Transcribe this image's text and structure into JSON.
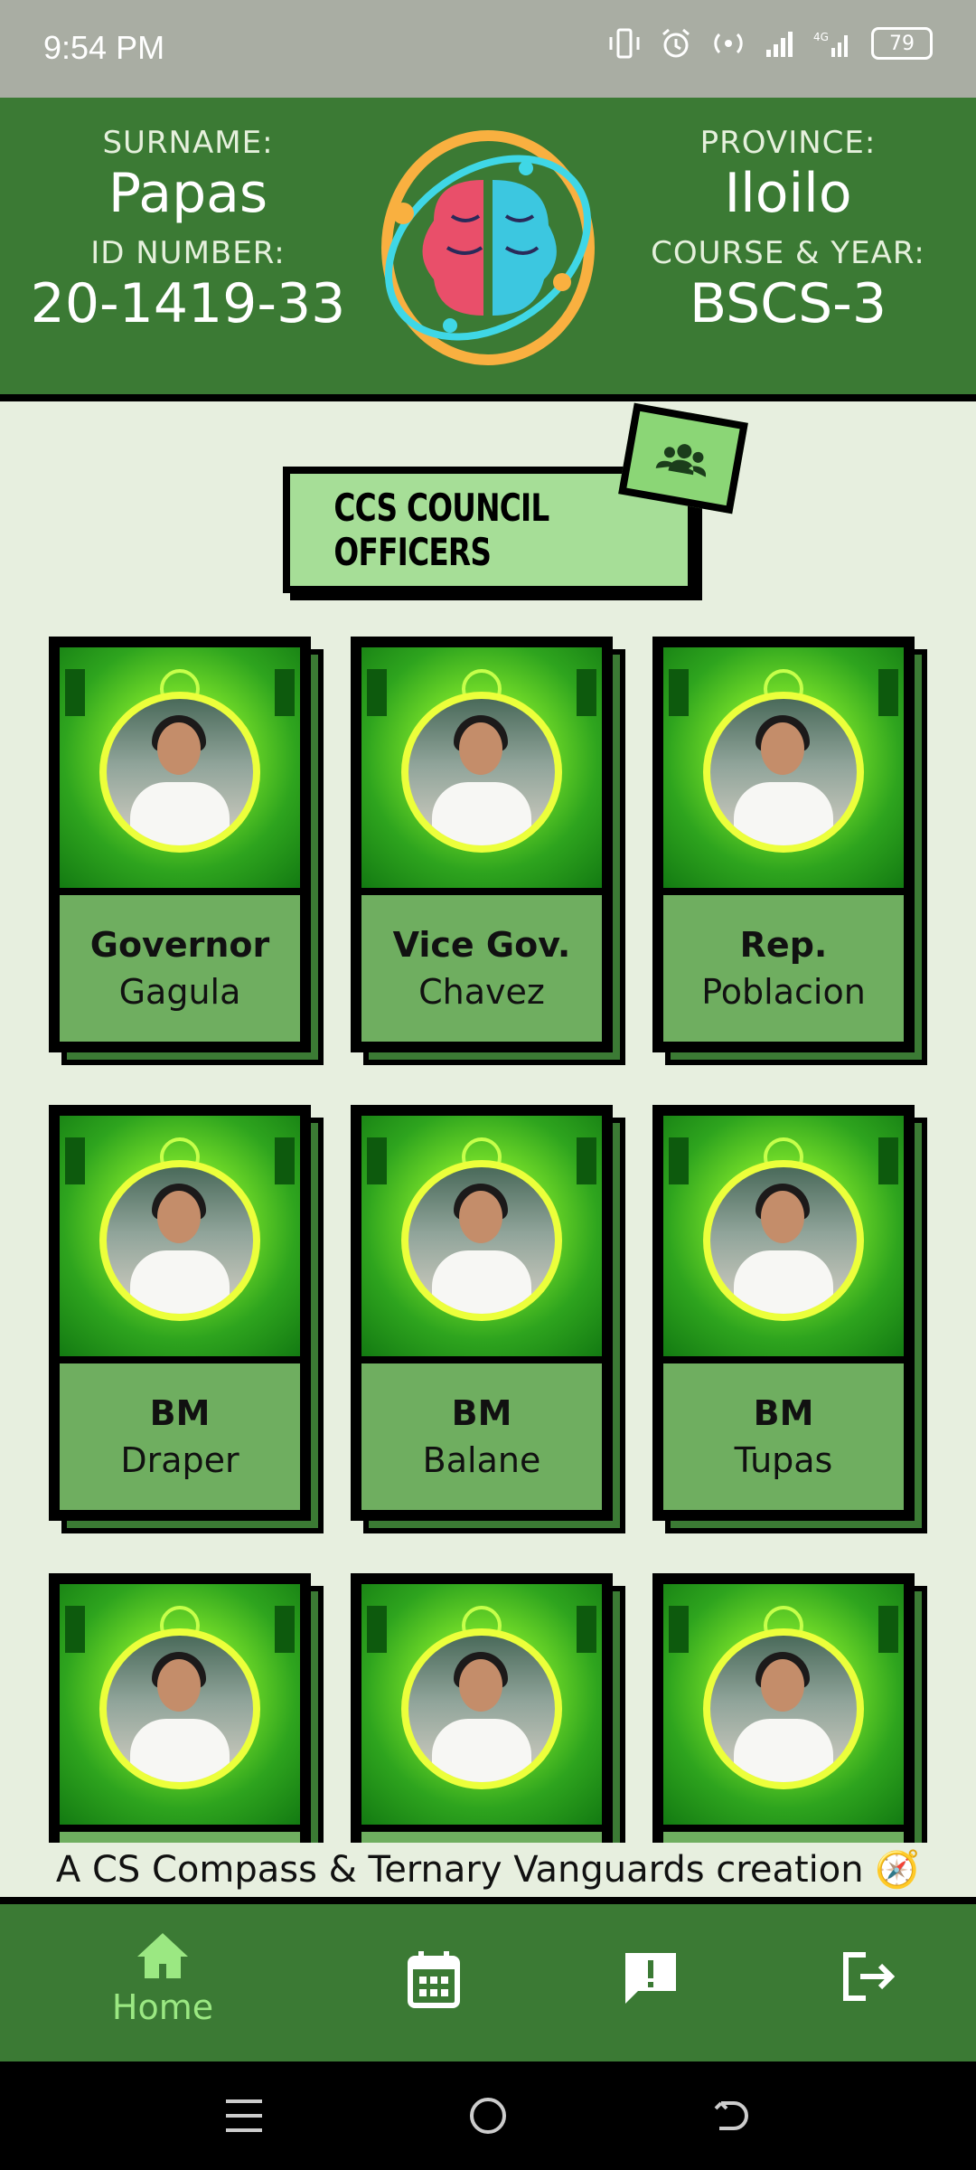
{
  "status_bar": {
    "time": "9:54 PM",
    "battery": "79",
    "network": "4G"
  },
  "profile": {
    "surname_label": "SURNAME:",
    "surname": "Papas",
    "id_label": "ID NUMBER:",
    "id_number": "20-1419-33",
    "province_label": "PROVINCE:",
    "province": "Iloilo",
    "course_label": "COURSE & YEAR:",
    "course": "BSCS-3"
  },
  "section": {
    "title": "CCS COUNCIL OFFICERS"
  },
  "officers": [
    {
      "role": "Governor",
      "name": "Gagula"
    },
    {
      "role": "Vice Gov.",
      "name": "Chavez"
    },
    {
      "role": "Rep.",
      "name": "Poblacion"
    },
    {
      "role": "BM",
      "name": "Draper"
    },
    {
      "role": "BM",
      "name": "Balane"
    },
    {
      "role": "BM",
      "name": "Tupas"
    },
    {
      "role": "",
      "name": ""
    },
    {
      "role": "",
      "name": ""
    },
    {
      "role": "",
      "name": ""
    }
  ],
  "footer": {
    "credit": "A CS Compass & Ternary Vanguards creation 🧭"
  },
  "bottom_nav": {
    "home": "Home",
    "active": "home"
  },
  "colors": {
    "header": "#3b7a34",
    "accent": "#a6de97",
    "bg": "#e7efdf",
    "active_nav": "#9be882"
  }
}
